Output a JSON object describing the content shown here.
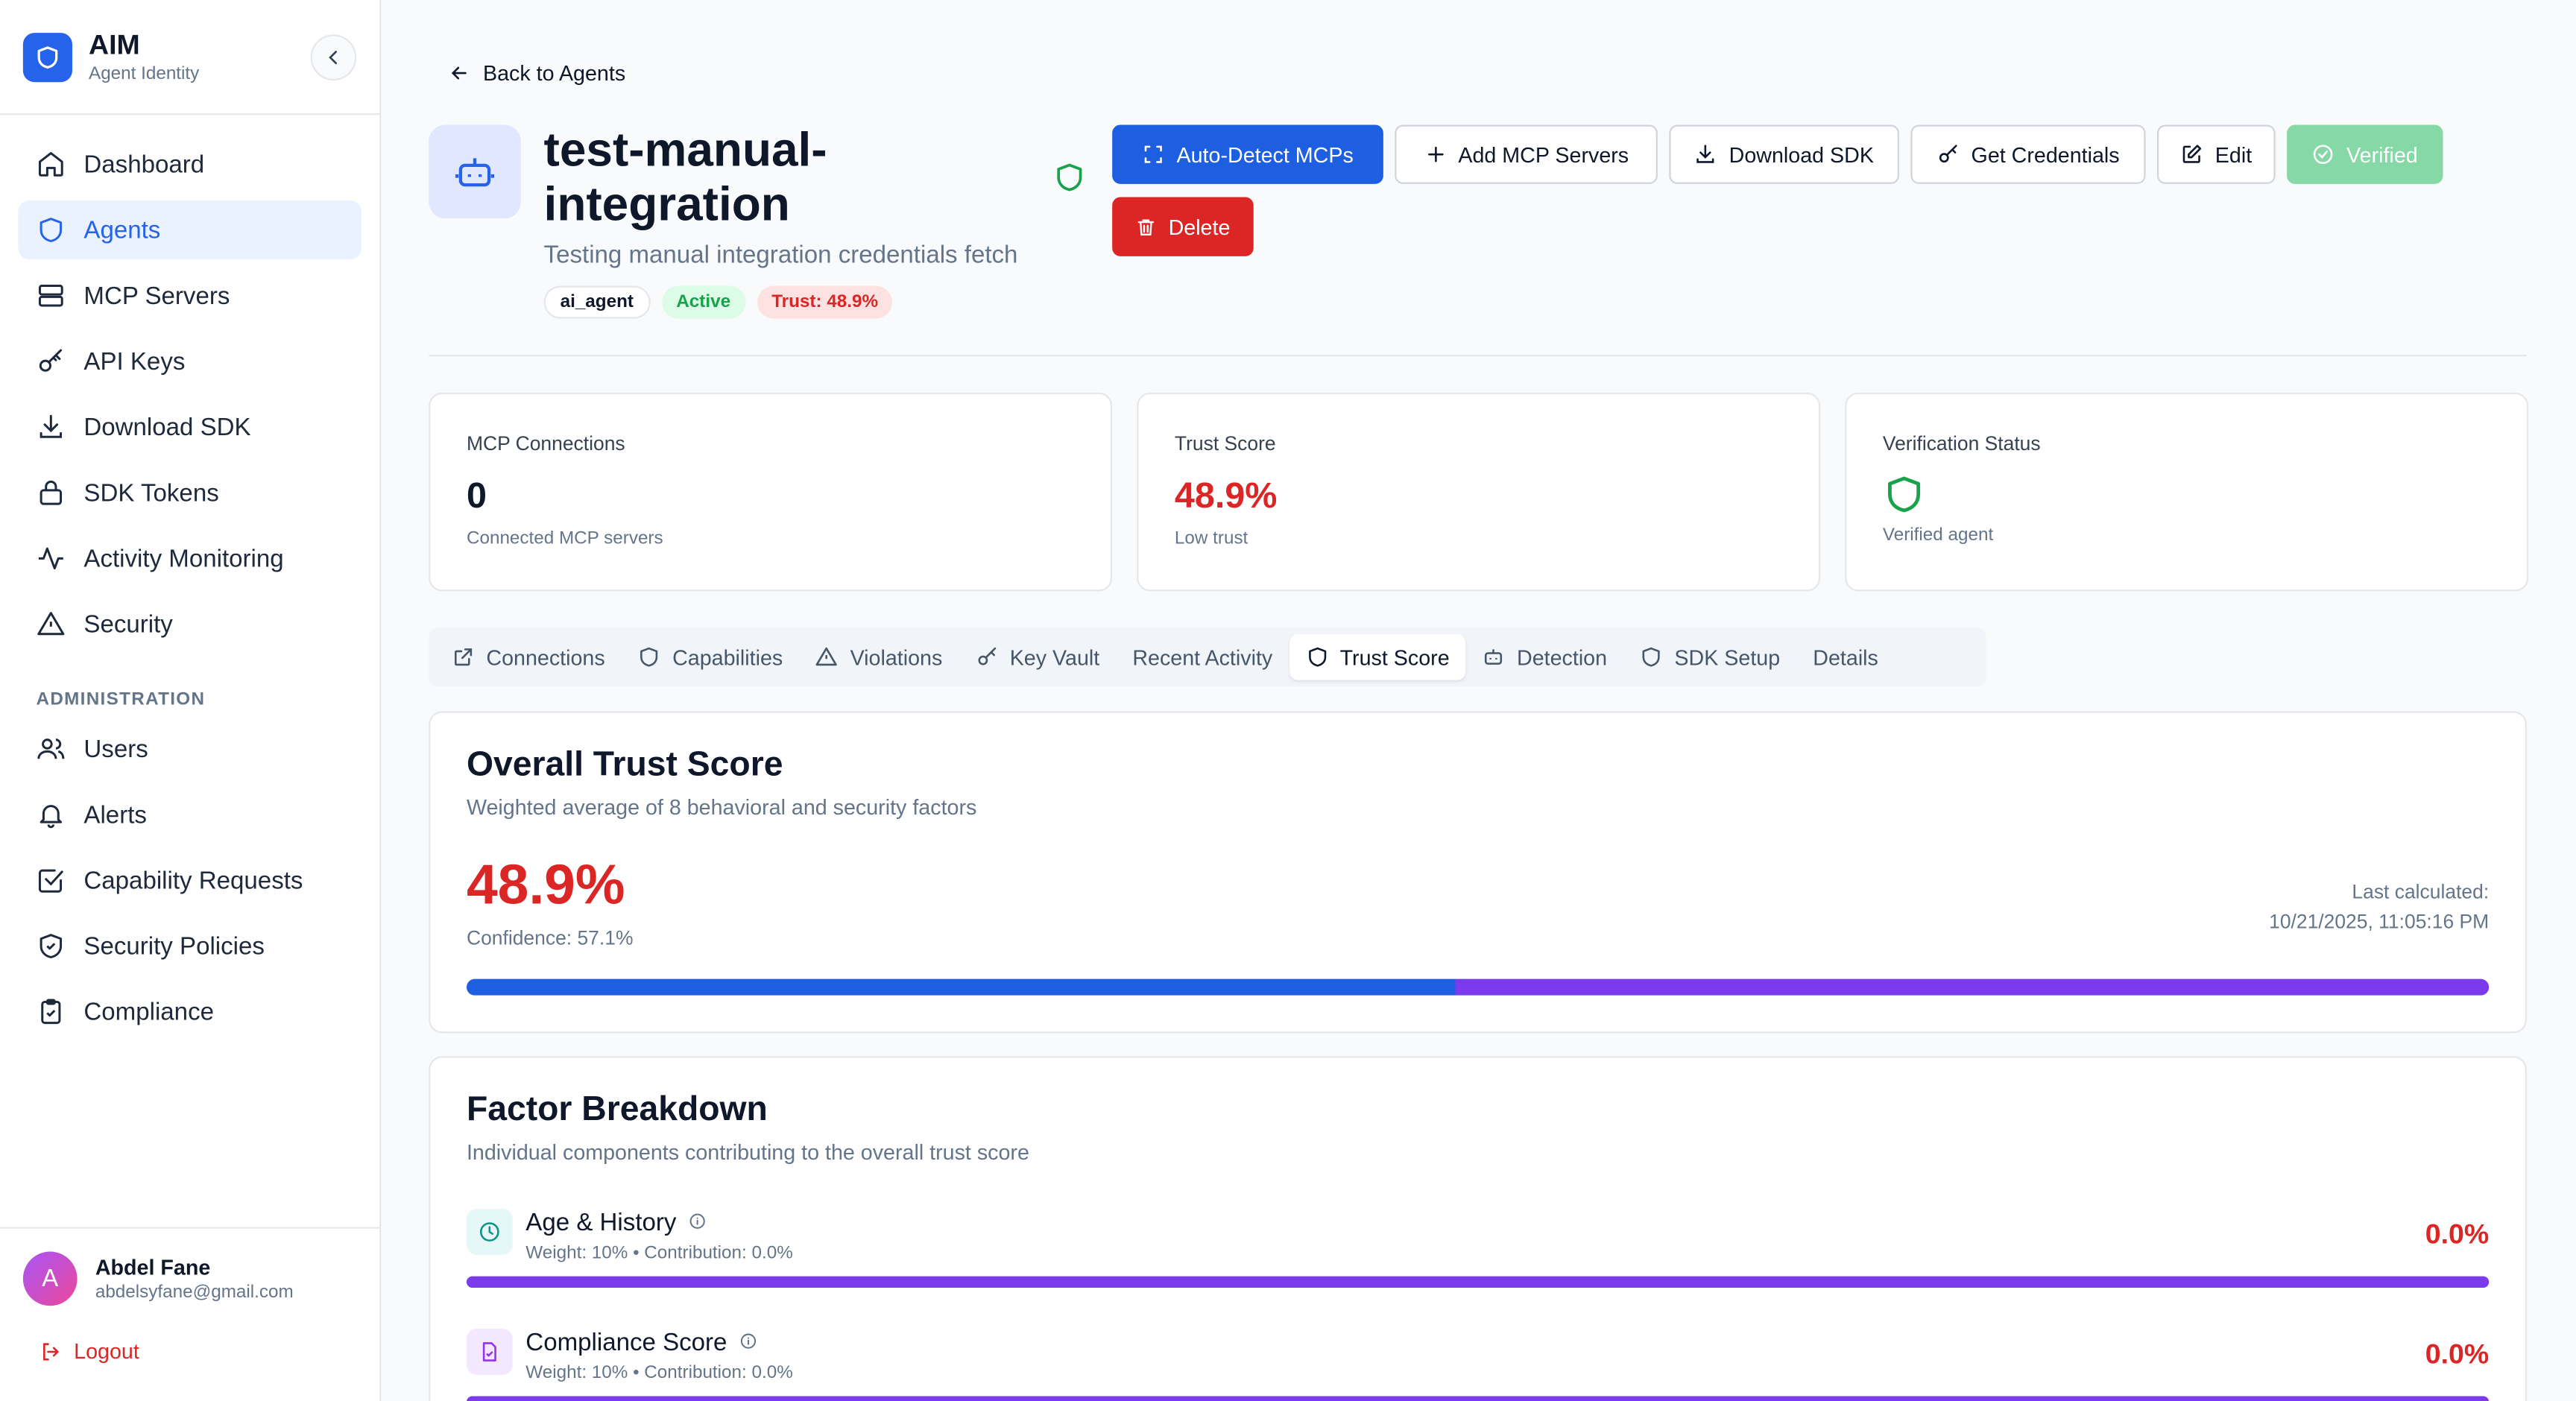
{
  "brand": {
    "title": "AIM",
    "subtitle": "Agent Identity"
  },
  "sidebar": {
    "items": [
      {
        "label": "Dashboard",
        "icon": "home-icon"
      },
      {
        "label": "Agents",
        "icon": "shield-icon",
        "active": true
      },
      {
        "label": "MCP Servers",
        "icon": "server-icon"
      },
      {
        "label": "API Keys",
        "icon": "key-icon"
      },
      {
        "label": "Download SDK",
        "icon": "download-icon"
      },
      {
        "label": "SDK Tokens",
        "icon": "lock-icon"
      },
      {
        "label": "Activity Monitoring",
        "icon": "activity-icon"
      },
      {
        "label": "Security",
        "icon": "alert-triangle-icon"
      }
    ],
    "admin_section": "ADMINISTRATION",
    "admin_items": [
      {
        "label": "Users",
        "icon": "users-icon"
      },
      {
        "label": "Alerts",
        "icon": "bell-icon"
      },
      {
        "label": "Capability Requests",
        "icon": "check-square-icon"
      },
      {
        "label": "Security Policies",
        "icon": "shield-check-icon"
      },
      {
        "label": "Compliance",
        "icon": "clipboard-check-icon"
      }
    ],
    "user": {
      "initial": "A",
      "name": "Abdel Fane",
      "email": "abdelsyfane@gmail.com"
    },
    "logout_label": "Logout"
  },
  "header": {
    "back_label": "Back to Agents",
    "agent_name": "test-manual-integration",
    "agent_description": "Testing manual integration credentials fetch",
    "badges": {
      "type": "ai_agent",
      "status": "Active",
      "trust": "Trust: 48.9%"
    }
  },
  "actions": {
    "auto_detect": "Auto-Detect MCPs",
    "add_mcp": "Add MCP Servers",
    "download_sdk": "Download SDK",
    "get_credentials": "Get Credentials",
    "edit": "Edit",
    "verified": "Verified",
    "delete": "Delete"
  },
  "stats": {
    "mcp": {
      "label": "MCP Connections",
      "value": "0",
      "sub": "Connected MCP servers"
    },
    "trust": {
      "label": "Trust Score",
      "value": "48.9%",
      "sub": "Low trust"
    },
    "verification": {
      "label": "Verification Status",
      "sub": "Verified agent"
    }
  },
  "tabs": [
    "Connections",
    "Capabilities",
    "Violations",
    "Key Vault",
    "Recent Activity",
    "Trust Score",
    "Detection",
    "SDK Setup",
    "Details"
  ],
  "active_tab": "Trust Score",
  "overall": {
    "title": "Overall Trust Score",
    "subtitle": "Weighted average of 8 behavioral and security factors",
    "score": "48.9%",
    "score_fraction": 0.489,
    "confidence": "Confidence: 57.1%",
    "last_calculated_label": "Last calculated:",
    "last_calculated_value": "10/21/2025, 11:05:16 PM"
  },
  "factors": {
    "title": "Factor Breakdown",
    "subtitle": "Individual components contributing to the overall trust score",
    "items": [
      {
        "name": "Age & History",
        "meta": "Weight: 10% • Contribution: 0.0%",
        "value": "0.0%",
        "icon": "clock-icon"
      },
      {
        "name": "Compliance Score",
        "meta": "Weight: 10% • Contribution: 0.0%",
        "value": "0.0%",
        "icon": "file-check-icon"
      }
    ]
  },
  "colors": {
    "accent": "#1d5fe0",
    "danger": "#dc2626",
    "success": "#16a34a",
    "purple": "#7c3aed"
  }
}
